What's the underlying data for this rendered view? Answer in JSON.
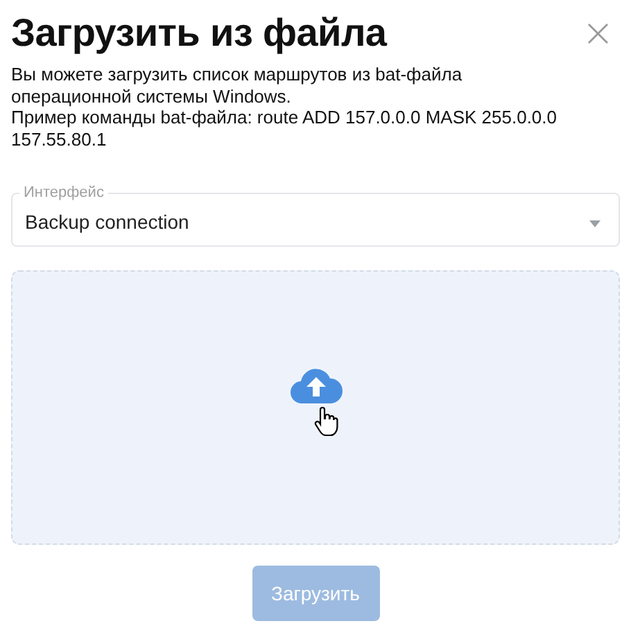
{
  "dialog": {
    "title": "Загрузить из файла",
    "close": "×"
  },
  "description": [
    "Вы можете загрузить список маршрутов из bat-файла операционной системы Windows.",
    "Пример команды bat-файла: route ADD 157.0.0.0 MASK 255.0.0.0 157.55.80.1"
  ],
  "interface_field": {
    "label": "Интерфейс",
    "value": "Backup connection"
  },
  "dropzone": {
    "hover": true
  },
  "upload_button": {
    "label": "Загрузить",
    "disabled": true
  }
}
